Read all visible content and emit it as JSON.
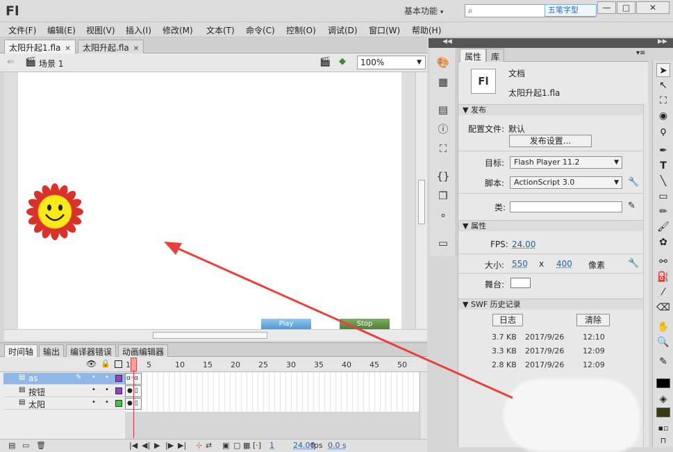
{
  "app": {
    "logo": "Fl",
    "workspace": "基本功能",
    "search_placeholder": "",
    "badge": "五笔字型",
    "win_min": "—",
    "win_max": "□",
    "win_close": "✕"
  },
  "menu": [
    "文件(F)",
    "编辑(E)",
    "视图(V)",
    "插入(I)",
    "修改(M)",
    "文本(T)",
    "命令(C)",
    "控制(O)",
    "调试(D)",
    "窗口(W)",
    "帮助(H)"
  ],
  "tabs": [
    {
      "label": "太阳升起1.fla"
    },
    {
      "label": "太阳升起.fla"
    }
  ],
  "scene": {
    "label": "场景 1",
    "zoom": "100%"
  },
  "stage": {
    "play_label": "Play",
    "stop_label": "Stop",
    "play_color": "#5ea6d6",
    "stop_color": "#5c8a4a"
  },
  "timeline": {
    "tabs": [
      "时间轴",
      "输出",
      "编译器错误",
      "动画编辑器"
    ],
    "frame_numbers": [
      "1",
      "5",
      "10",
      "15",
      "20",
      "25",
      "30",
      "35",
      "40",
      "45",
      "50"
    ],
    "layers": [
      {
        "name": "as",
        "color": "#9b3fc8",
        "selected": true
      },
      {
        "name": "按钮",
        "color": "#9b3fc8",
        "selected": false
      },
      {
        "name": "太阳",
        "color": "#3ec83e",
        "selected": false
      }
    ],
    "current_frame": "1",
    "fps": "24.00",
    "fps_unit": "fps",
    "time": "0.0 s"
  },
  "properties": {
    "tabs": [
      "属性",
      "库"
    ],
    "doc_type": "文档",
    "doc_name": "太阳升起1.fla",
    "thumb": "Fl",
    "publish_section": "发布",
    "profile_label": "配置文件:",
    "profile_value": "默认",
    "publish_settings_button": "发布设置...",
    "target_label": "目标:",
    "target_value": "Flash Player 11.2",
    "script_label": "脚本:",
    "script_value": "ActionScript 3.0",
    "class_label": "类:",
    "class_value": "",
    "props_section": "属性",
    "fps_label": "FPS:",
    "fps_value": "24.00",
    "size_label": "大小:",
    "width": "550",
    "x": "x",
    "height": "400",
    "unit": "像素",
    "stage_label": "舞台:",
    "stage_color": "#ffffff",
    "swf_section": "SWF 历史记录",
    "log_button": "日志",
    "clear_button": "清除",
    "history": [
      {
        "size": "3.7 KB",
        "date": "2017/9/26",
        "time": "12:10"
      },
      {
        "size": "3.3 KB",
        "date": "2017/9/26",
        "time": "12:09"
      },
      {
        "size": "2.8 KB",
        "date": "2017/9/26",
        "time": "12:09"
      }
    ]
  },
  "annotation": {
    "arrow_color": "#e8413c"
  },
  "colors": {
    "stroke_swatch": "#000000",
    "fill_swatch": "#3a3a10"
  }
}
